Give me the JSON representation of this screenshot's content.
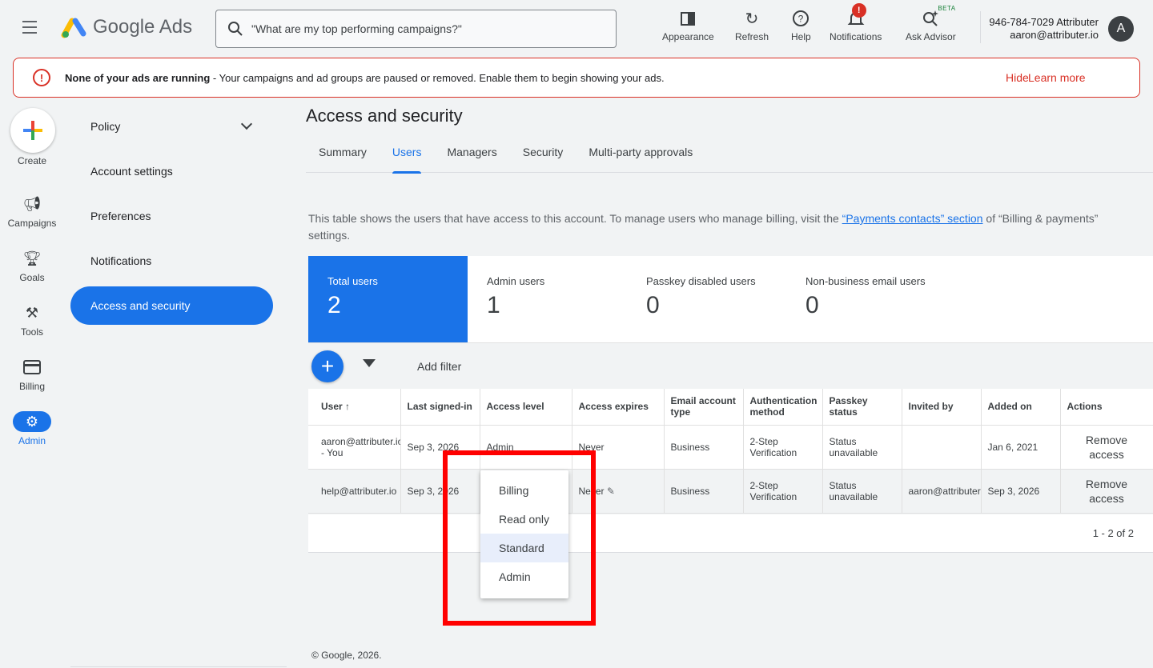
{
  "header": {
    "logo_text": "Google Ads",
    "search_placeholder": "\"What are my top performing campaigns?\"",
    "tools": [
      {
        "label": "Appearance",
        "icon": "appearance-icon"
      },
      {
        "label": "Refresh",
        "icon": "refresh-icon"
      },
      {
        "label": "Help",
        "icon": "help-icon"
      },
      {
        "label": "Notifications",
        "icon": "bell-icon",
        "badge": "!"
      },
      {
        "label": "Ask Advisor",
        "icon": "advisor-icon",
        "badge": "BETA"
      }
    ],
    "account_line1": "946-784-7029 Attributer",
    "account_line2": "aaron@attributer.io",
    "avatar_letter": "A"
  },
  "alert": {
    "bold": "None of your ads are running",
    "text": " - Your campaigns and ad groups are paused or removed. Enable them to begin showing your ads.",
    "hide": "Hide",
    "learn_more": "Learn more"
  },
  "rail": {
    "create": "Create",
    "items": [
      "Campaigns",
      "Goals",
      "Tools",
      "Billing",
      "Admin"
    ]
  },
  "nav": {
    "items": [
      "Policy",
      "Account settings",
      "Preferences",
      "Notifications",
      "Access and security"
    ]
  },
  "page": {
    "title": "Access and security",
    "tabs": [
      "Summary",
      "Users",
      "Managers",
      "Security",
      "Multi-party approvals"
    ],
    "desc_before": "This table shows the users that have access to this account. To manage users who manage billing, visit the ",
    "desc_link": "“Payments contacts” section",
    "desc_after": " of “Billing & payments” settings."
  },
  "stats": [
    {
      "label": "Total users",
      "value": "2"
    },
    {
      "label": "Admin users",
      "value": "1"
    },
    {
      "label": "Passkey disabled users",
      "value": "0"
    },
    {
      "label": "Non-business email users",
      "value": "0"
    }
  ],
  "toolbar": {
    "add_filter": "Add filter"
  },
  "table": {
    "headers": [
      "User ↑",
      "Last signed-in",
      "Access level",
      "Access expires",
      "Email account type",
      "Authentication method",
      "Passkey status",
      "Invited by",
      "Added on",
      "Actions"
    ],
    "rows": [
      {
        "user": "aaron@attributer.io - You",
        "last": "Sep 3, 2026",
        "access": "Admin",
        "expires": "Never",
        "email_type": "Business",
        "auth": "2-Step Verification",
        "passkey": "Status unavailable",
        "invited": "",
        "added": "Jan 6, 2021",
        "action": "Remove access"
      },
      {
        "user": "help@attributer.io",
        "last": "Sep 3, 2026",
        "access": "",
        "expires": "Never",
        "email_type": "Business",
        "auth": "2-Step Verification",
        "passkey": "Status unavailable",
        "invited": "aaron@attributer.io",
        "added": "Sep 3, 2026",
        "action": "Remove access"
      }
    ],
    "pager": "1 - 2 of 2"
  },
  "dropdown": {
    "options": [
      "Billing",
      "Read only",
      "Standard",
      "Admin"
    ],
    "highlighted": "Standard"
  },
  "footer": "© Google, 2026."
}
